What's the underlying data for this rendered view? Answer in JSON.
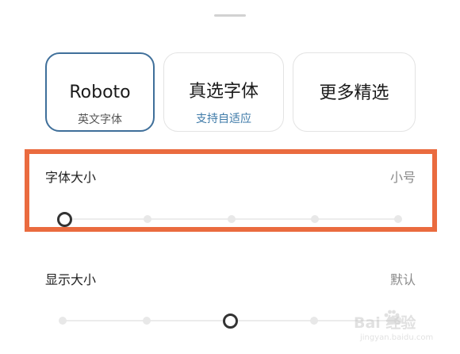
{
  "font_options": [
    {
      "title": "Roboto",
      "subtitle": "英文字体",
      "selected": true
    },
    {
      "title": "真选字体",
      "subtitle": "支持自适应",
      "selected": false
    },
    {
      "title": "更多精选",
      "subtitle": "",
      "selected": false
    }
  ],
  "font_size": {
    "label": "字体大小",
    "value": "小号",
    "steps": 5,
    "selected_index": 0
  },
  "display_size": {
    "label": "显示大小",
    "value": "默认",
    "steps": 5,
    "selected_index": 2
  },
  "highlight_color": "#ea6b3f",
  "accent_color": "#3f6f9a",
  "watermark": {
    "brand": "Bai  经验",
    "domain": "jingyan.baidu.com"
  }
}
